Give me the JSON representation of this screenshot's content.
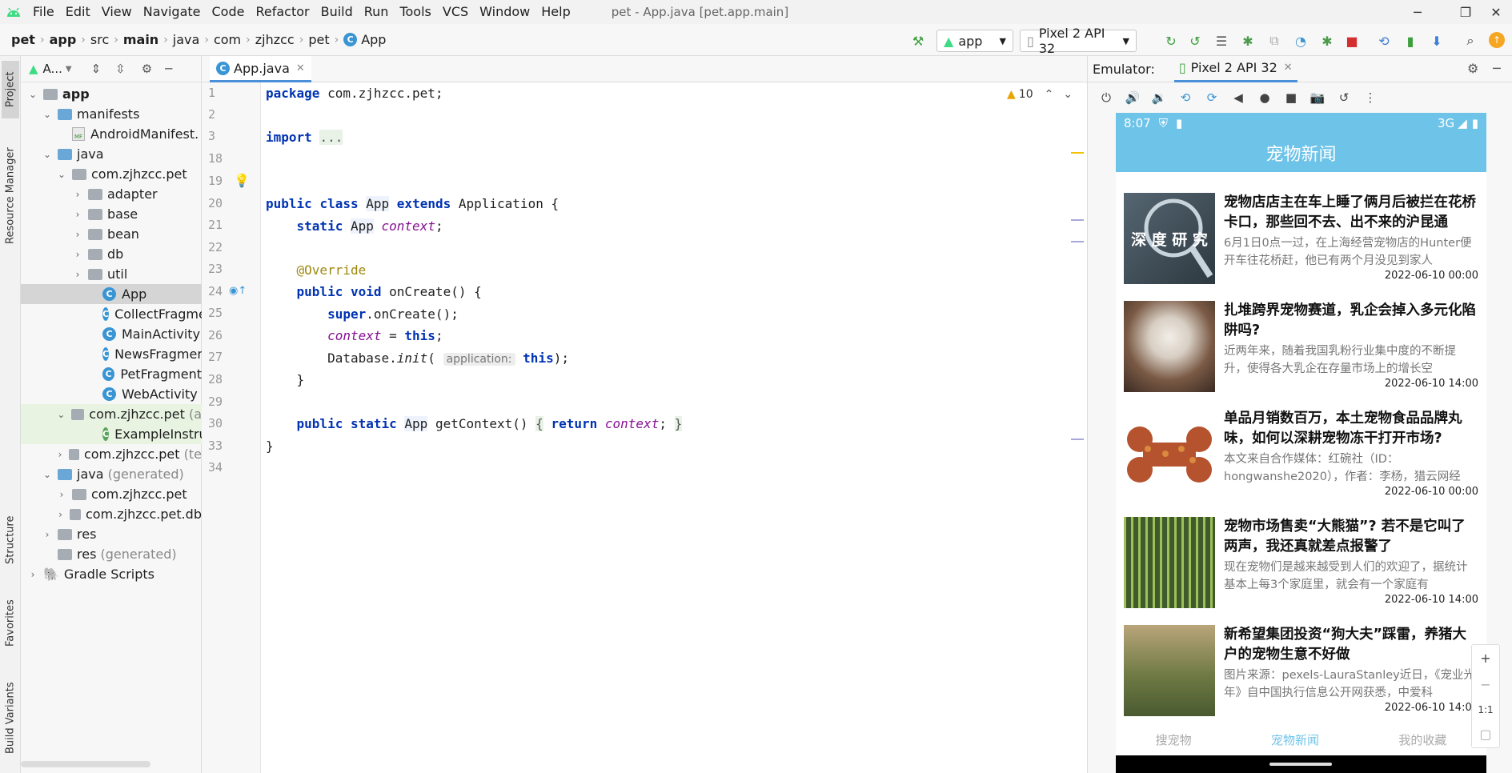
{
  "menubar": {
    "items": [
      "File",
      "Edit",
      "View",
      "Navigate",
      "Code",
      "Refactor",
      "Build",
      "Run",
      "Tools",
      "VCS",
      "Window",
      "Help"
    ],
    "window_title": "pet - App.java [pet.app.main]"
  },
  "navbar": {
    "breadcrumbs": [
      "pet",
      "app",
      "src",
      "main",
      "java",
      "com",
      "zjhzcc",
      "pet",
      "App"
    ],
    "run_config": "app",
    "device": "Pixel 2 API 32"
  },
  "left_strip": {
    "tabs": [
      "Project",
      "Resource Manager",
      "Structure",
      "Favorites",
      "Build Variants"
    ]
  },
  "project": {
    "header_label": "A...",
    "tree": [
      {
        "label": "app",
        "suffix": ""
      },
      {
        "label": "manifests",
        "suffix": ""
      },
      {
        "label": "AndroidManifest.",
        "suffix": ""
      },
      {
        "label": "java",
        "suffix": ""
      },
      {
        "label": "com.zjhzcc.pet",
        "suffix": ""
      },
      {
        "label": "adapter",
        "suffix": ""
      },
      {
        "label": "base",
        "suffix": ""
      },
      {
        "label": "bean",
        "suffix": ""
      },
      {
        "label": "db",
        "suffix": ""
      },
      {
        "label": "util",
        "suffix": ""
      },
      {
        "label": "App",
        "suffix": ""
      },
      {
        "label": "CollectFragme",
        "suffix": ""
      },
      {
        "label": "MainActivity",
        "suffix": ""
      },
      {
        "label": "NewsFragmen",
        "suffix": ""
      },
      {
        "label": "PetFragment",
        "suffix": ""
      },
      {
        "label": "WebActivity",
        "suffix": ""
      },
      {
        "label": "com.zjhzcc.pet",
        "suffix": "(a"
      },
      {
        "label": "ExampleInstru",
        "suffix": ""
      },
      {
        "label": "com.zjhzcc.pet",
        "suffix": "(te"
      },
      {
        "label": "java",
        "suffix": "(generated)"
      },
      {
        "label": "com.zjhzcc.pet",
        "suffix": ""
      },
      {
        "label": "com.zjhzcc.pet.db",
        "suffix": ""
      },
      {
        "label": "res",
        "suffix": ""
      },
      {
        "label": "res",
        "suffix": "(generated)"
      },
      {
        "label": "Gradle Scripts",
        "suffix": ""
      }
    ]
  },
  "editor": {
    "tab": "App.java",
    "warning_count": "10",
    "line_numbers": [
      "1",
      "2",
      "3",
      "18",
      "19",
      "20",
      "21",
      "22",
      "23",
      "24",
      "25",
      "26",
      "27",
      "28",
      "29",
      "30",
      "33",
      "34"
    ],
    "code": {
      "l1_kw": "package",
      "l1_rest": " com.zjhzcc.pet;",
      "l3_kw": "import",
      "l3_fold": "...",
      "l20_kw1": "public",
      "l20_kw2": "class",
      "l20_cls": "App",
      "l20_kw3": "extends",
      "l20_rest": " Application {",
      "l21_kw": "static",
      "l21_cls": "App",
      "l21_field": "context",
      "l21_end": ";",
      "l23_ann": "@Override",
      "l24_kw1": "public",
      "l24_kw2": "void",
      "l24_rest": " onCreate() {",
      "l25_kw": "super",
      "l25_rest": ".onCreate();",
      "l26_field": "context",
      "l26_op": " = ",
      "l26_kw": "this",
      "l26_end": ";",
      "l27_a": "Database.",
      "l27_m": "init",
      "l27_b": "(",
      "l27_hint": "application:",
      "l27_kw": "this",
      "l27_end": ");",
      "l28": "}",
      "l30_kw1": "public",
      "l30_kw2": "static",
      "l30_cls": "App",
      "l30_rest": " getContext() ",
      "l30_fold_open": "{",
      "l30_kw3": "return",
      "l30_field": "context",
      "l30_semi": ";",
      "l30_fold_close": "}",
      "l33": "}"
    }
  },
  "emulator": {
    "label": "Emulator:",
    "tab": "Pixel 2 API 32"
  },
  "phone": {
    "status_time": "8:07",
    "status_network": "3G",
    "app_title": "宠物新闻",
    "news": [
      {
        "title": "宠物店店主在车上睡了俩月后被拦在花桥卡口，那些回不去、出不来的沪昆通",
        "summary": "6月1日0点一过，在上海经营宠物店的Hunter便开车往花桥赶，他已有两个月没见到家人",
        "date": "2022-06-10 00:00",
        "thumb_text": "深 度 研 究"
      },
      {
        "title": "扎堆跨界宠物赛道，乳企会掉入多元化陷阱吗?",
        "summary": "近两年来，随着我国乳粉行业集中度的不断提升，使得各大乳企在存量市场上的增长空",
        "date": "2022-06-10 14:00",
        "thumb_text": ""
      },
      {
        "title": "单品月销数百万，本土宠物食品品牌丸味，如何以深耕宠物冻干打开市场?",
        "summary": "本文来自合作媒体：红碗社（ID：hongwanshe2020），作者：李杨，猎云网经",
        "date": "2022-06-10 00:00",
        "thumb_text": ""
      },
      {
        "title": "宠物市场售卖“大熊猫”? 若不是它叫了两声，我还真就差点报警了",
        "summary": "现在宠物们是越来越受到人们的欢迎了，据统计基本上每3个家庭里，就会有一个家庭有",
        "date": "2022-06-10 14:00",
        "thumb_text": ""
      },
      {
        "title": "新希望集团投资“狗大夫”踩雷，养猪大户的宠物生意不好做",
        "summary": "图片来源：pexels-LauraStanley近日，《宠业光年》自中国执行信息公开网获悉，中爱科",
        "date": "2022-06-10 14:00",
        "thumb_text": ""
      }
    ],
    "bottom_nav": [
      "搜宠物",
      "宠物新闻",
      "我的收藏"
    ]
  },
  "zoom": {
    "plus": "+",
    "minus": "−",
    "ratio": "1:1"
  }
}
